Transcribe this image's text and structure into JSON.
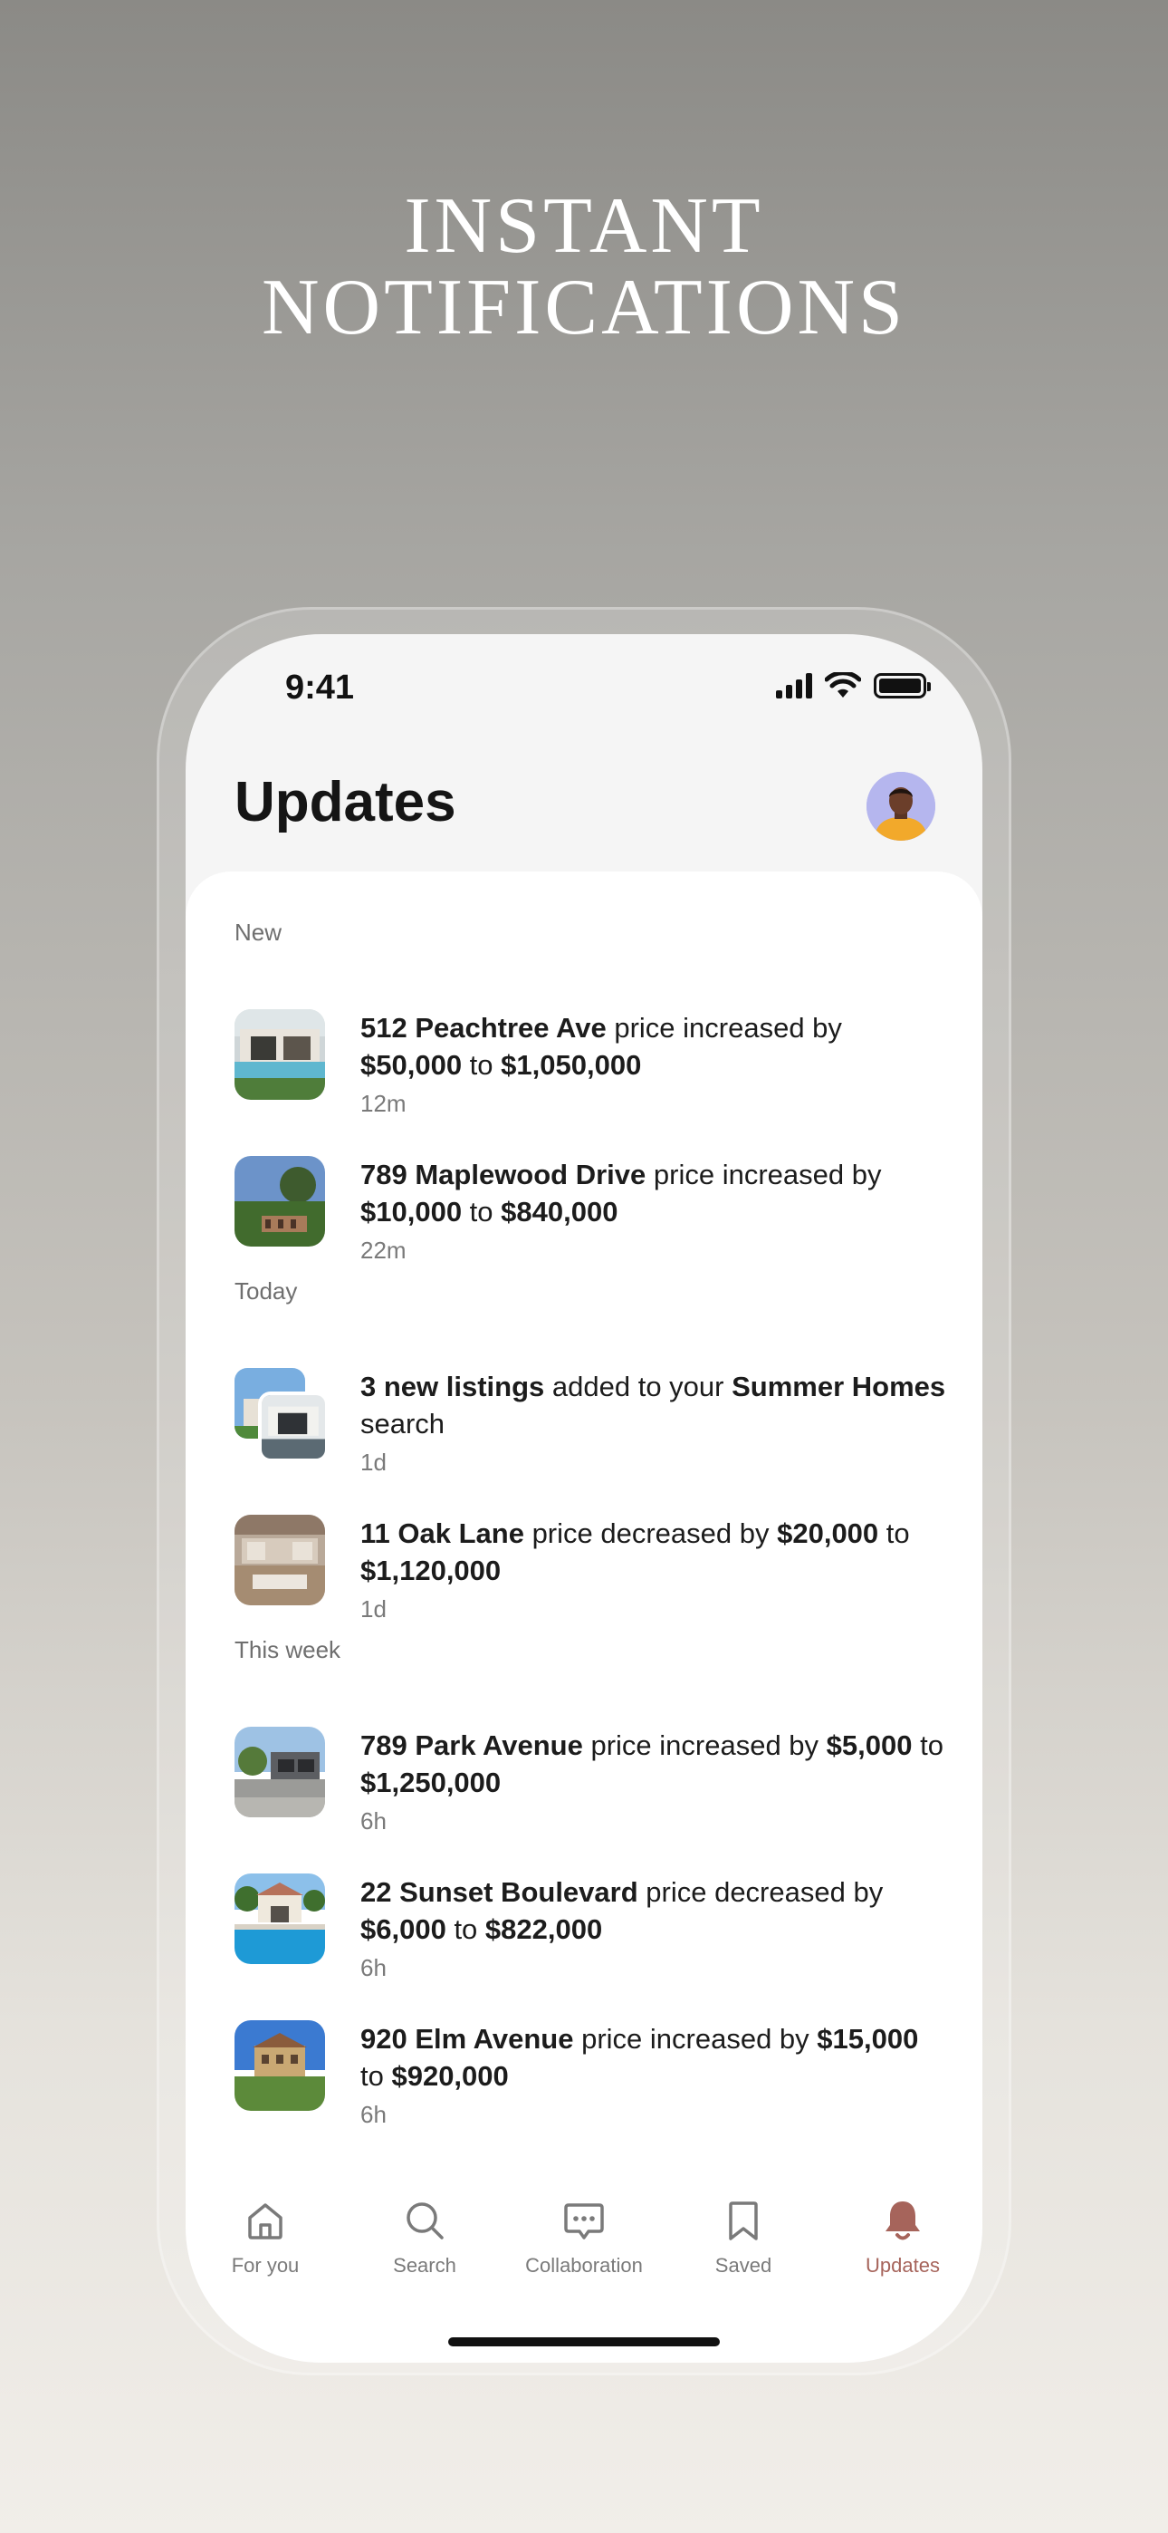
{
  "headline": {
    "line1": "INSTANT",
    "line2": "NOTIFICATIONS"
  },
  "status_bar": {
    "time": "9:41"
  },
  "header": {
    "title": "Updates"
  },
  "sections": [
    {
      "label": "New",
      "items": [
        {
          "parts": [
            {
              "b": "512 Peachtree Ave"
            },
            {
              "t": " price increased by "
            },
            {
              "b": "$50,000"
            },
            {
              "t": " to "
            },
            {
              "b": "$1,050,000"
            }
          ],
          "time": "12m",
          "thumb": "pool-house"
        },
        {
          "parts": [
            {
              "b": "789 Maplewood Drive"
            },
            {
              "t": " price increased by "
            },
            {
              "b": "$10,000"
            },
            {
              "t": " to "
            },
            {
              "b": "$840,000"
            }
          ],
          "time": "22m",
          "thumb": "hillside-house"
        }
      ]
    },
    {
      "label": "Today",
      "items": [
        {
          "parts": [
            {
              "b": "3 new listings"
            },
            {
              "t": " added to your "
            },
            {
              "b": "Summer Homes"
            },
            {
              "t": " search"
            }
          ],
          "time": "1d",
          "thumb": "stacked"
        },
        {
          "parts": [
            {
              "b": "11 Oak Lane"
            },
            {
              "t": " price decreased by "
            },
            {
              "b": "$20,000"
            },
            {
              "t": " to "
            },
            {
              "b": "$1,120,000"
            }
          ],
          "time": "1d",
          "thumb": "living-room"
        }
      ]
    },
    {
      "label": "This week",
      "items": [
        {
          "parts": [
            {
              "b": "789 Park Avenue"
            },
            {
              "t": " price increased by "
            },
            {
              "b": "$5,000"
            },
            {
              "t": " to "
            },
            {
              "b": "$1,250,000"
            }
          ],
          "time": "6h",
          "thumb": "driveway-house"
        },
        {
          "parts": [
            {
              "b": "22 Sunset Boulevard"
            },
            {
              "t": " price decreased by "
            },
            {
              "b": "$6,000"
            },
            {
              "t": " to "
            },
            {
              "b": "$822,000"
            }
          ],
          "time": "6h",
          "thumb": "pool-villa"
        },
        {
          "parts": [
            {
              "b": "920 Elm Avenue"
            },
            {
              "t": " price increased by "
            },
            {
              "b": "$15,000"
            },
            {
              "t": " to "
            },
            {
              "b": "$920,000"
            }
          ],
          "time": "6h",
          "thumb": "mansion"
        }
      ]
    }
  ],
  "tabbar": {
    "items": [
      {
        "label": "For you",
        "icon": "home-icon"
      },
      {
        "label": "Search",
        "icon": "search-icon"
      },
      {
        "label": "Collaboration",
        "icon": "chat-icon"
      },
      {
        "label": "Saved",
        "icon": "bookmark-icon"
      },
      {
        "label": "Updates",
        "icon": "bell-icon",
        "active": true
      }
    ],
    "active_color": "#a6645b",
    "inactive_color": "#7a7a7a"
  }
}
